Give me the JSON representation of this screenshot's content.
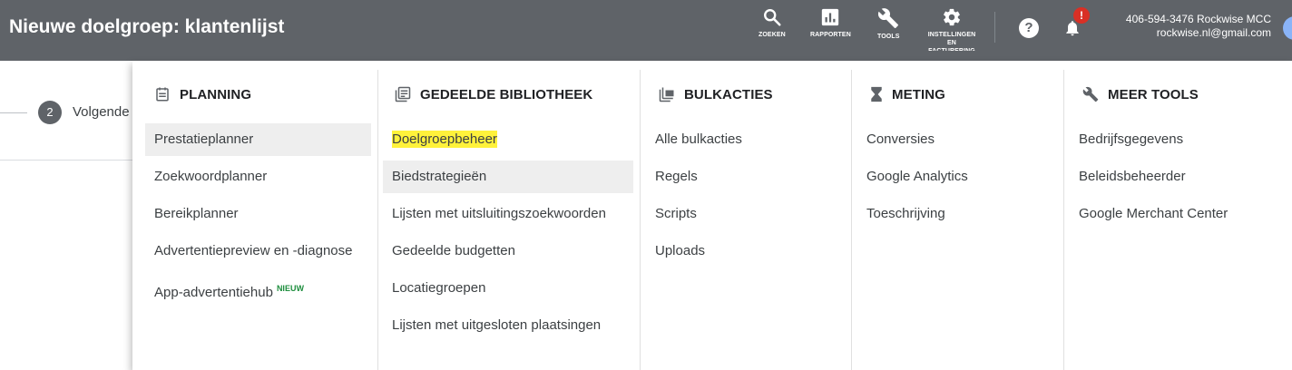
{
  "header": {
    "title": "Nieuwe doelgroep: klantenlijst",
    "nav": [
      {
        "label": "ZOEKEN",
        "icon": "search-icon"
      },
      {
        "label": "RAPPORTEN",
        "icon": "reports-icon"
      },
      {
        "label": "TOOLS",
        "icon": "wrench-icon"
      },
      {
        "label": "INSTELLINGEN\nEN\nFACTURERING",
        "icon": "gear-icon"
      }
    ],
    "help_glyph": "?",
    "notification_badge": "!",
    "account_line1": "406-594-3476 Rockwise MCC",
    "account_line2": "rockwise.nl@gmail.com",
    "bar_color": "#5f6368"
  },
  "stepper": {
    "number": "2",
    "label": "Volgende"
  },
  "menu": {
    "columns": [
      {
        "heading": "PLANNING",
        "icon": "planning-icon",
        "items": [
          "Prestatieplanner",
          "Zoekwoordplanner",
          "Bereikplanner",
          "Advertentiepreview en -diagnose",
          "App-advertentiehub"
        ],
        "new_tag": "NIEUW"
      },
      {
        "heading": "GEDEELDE BIBLIOTHEEK",
        "icon": "library-icon",
        "items": [
          "Doelgroepbeheer",
          "Biedstrategieën",
          "Lijsten met uitsluitingszoekwoorden",
          "Gedeelde budgetten",
          "Locatiegroepen",
          "Lijsten met uitgesloten plaatsingen"
        ]
      },
      {
        "heading": "BULKACTIES",
        "icon": "bulk-actions-icon",
        "items": [
          "Alle bulkacties",
          "Regels",
          "Scripts",
          "Uploads"
        ]
      },
      {
        "heading": "METING",
        "icon": "hourglass-icon",
        "items": [
          "Conversies",
          "Google Analytics",
          "Toeschrijving"
        ]
      },
      {
        "heading": "MEER TOOLS",
        "icon": "wrench-icon",
        "items": [
          "Bedrijfsgegevens",
          "Beleidsbeheerder",
          "Google Merchant Center"
        ]
      }
    ],
    "highlight_color": "#fff23b"
  }
}
